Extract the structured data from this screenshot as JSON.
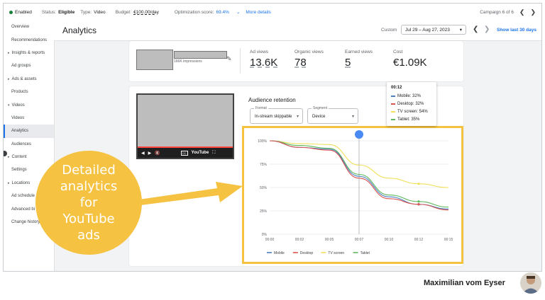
{
  "topbar": {
    "enabled": "Enabled",
    "status_label": "Status:",
    "status_value": "Eligible",
    "type_label": "Type:",
    "type_value": "Video",
    "budget_label": "Budget:",
    "budget_value": "€100.00/day",
    "opt_label": "Optimization score:",
    "opt_value": "69.4%",
    "more_details": "More details",
    "campaign_counter": "Campaign 6 of 6"
  },
  "header": {
    "title": "Analytics",
    "custom": "Custom",
    "date_range": "Jul 29 – Aug 27, 2023",
    "show_last": "Show last 30 days"
  },
  "sidebar": {
    "items": [
      {
        "label": "Overview",
        "caret": false
      },
      {
        "label": "Recommendations",
        "caret": false
      },
      {
        "label": "Insights & reports",
        "caret": true
      },
      {
        "label": "Ad groups",
        "caret": false
      },
      {
        "label": "Ads & assets",
        "caret": true
      },
      {
        "label": "Products",
        "caret": false
      },
      {
        "label": "Videos",
        "caret": true
      },
      {
        "label": "Videos",
        "caret": false
      },
      {
        "label": "Analytics",
        "caret": false
      },
      {
        "label": "Audiences",
        "caret": false
      },
      {
        "label": "Content",
        "caret": true
      },
      {
        "label": "Settings",
        "caret": false
      },
      {
        "label": "Locations",
        "caret": true
      },
      {
        "label": "Ad schedule",
        "caret": false
      },
      {
        "label": "Advanced bi",
        "caret": false
      },
      {
        "label": "Change history",
        "caret": false
      }
    ]
  },
  "metrics": {
    "impressions": "166K impressions",
    "ad_views_label": "Ad views",
    "ad_views_value": "13.6K",
    "organic_label": "Organic views",
    "organic_value": "78",
    "earned_label": "Earned views",
    "earned_value": "5",
    "cost_label": "Cost",
    "cost_value": "€1.09K"
  },
  "retention": {
    "title": "Audience retention",
    "format_caption": "Format",
    "format_value": "In-stream skippable",
    "segment_caption": "Segment",
    "segment_value": "Device",
    "video_brand": "YouTube"
  },
  "tooltip": {
    "time": "00:12",
    "rows": [
      {
        "label": "Mobile: 32%",
        "color": "#4a7fc1"
      },
      {
        "label": "Desktop: 32%",
        "color": "#d9534f"
      },
      {
        "label": "TV screen: 54%",
        "color": "#f0e05a"
      },
      {
        "label": "Tablet: 35%",
        "color": "#5cb85c"
      }
    ]
  },
  "chart_data": {
    "type": "line",
    "x": [
      "00:00",
      "00:02",
      "00:05",
      "00:07",
      "00:10",
      "00:12",
      "00:15"
    ],
    "y_ticks": [
      "100%",
      "75%",
      "50%",
      "25%",
      "0%"
    ],
    "ylim": [
      0,
      100
    ],
    "series": [
      {
        "name": "Mobile",
        "color": "#4a7fc1",
        "values": [
          100,
          93,
          91,
          62,
          40,
          32,
          27
        ]
      },
      {
        "name": "Desktop",
        "color": "#d9534f",
        "values": [
          100,
          93,
          90,
          60,
          38,
          32,
          26
        ]
      },
      {
        "name": "TV screen",
        "color": "#f0e05a",
        "values": [
          100,
          97,
          96,
          74,
          60,
          54,
          50
        ]
      },
      {
        "name": "Tablet",
        "color": "#5cb85c",
        "values": [
          100,
          95,
          92,
          64,
          42,
          35,
          29
        ]
      }
    ]
  },
  "overlay": {
    "line1": "Detailed",
    "line2": "analytics",
    "line3": "for",
    "line4": "YouTube",
    "line5": "ads"
  },
  "author": "Maximilian vom Eyser"
}
